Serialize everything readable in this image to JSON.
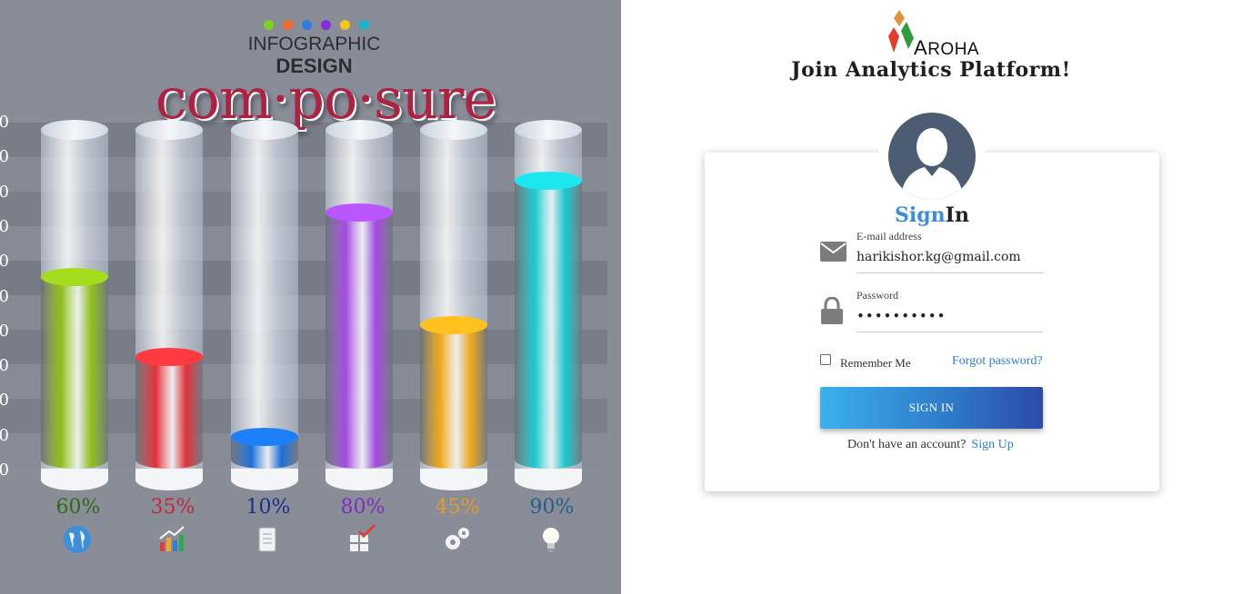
{
  "hero": {
    "dot_colors": [
      "#7ed321",
      "#f56a2a",
      "#2a7fe0",
      "#8a2be2",
      "#f5c518",
      "#19b4c6"
    ],
    "title_line1": "INFOGRAPHIC",
    "title_line2": "DESIGN",
    "brand": "com·po·sure",
    "chart_data": {
      "type": "bar",
      "categories": [
        "earth",
        "growth",
        "scroll",
        "checklist",
        "settings",
        "idea"
      ],
      "values": [
        60,
        35,
        10,
        80,
        45,
        90
      ],
      "value_labels": [
        "60%",
        "35%",
        "10%",
        "80%",
        "45%",
        "90%"
      ],
      "ylim": [
        0,
        100
      ],
      "series_colors": [
        "#8fbf1a",
        "#e03238",
        "#1a6fd8",
        "#a24be0",
        "#f0a81a",
        "#19c9cf"
      ],
      "label_colors": [
        "#2e6b16",
        "#c0283a",
        "#1b2f8a",
        "#7b2fbf",
        "#e79a2a",
        "#235f8a"
      ],
      "icons": [
        "globe-icon",
        "growth-chart-icon",
        "scroll-icon",
        "checklist-icon",
        "gears-icon",
        "lightbulb-icon"
      ]
    }
  },
  "logo": {
    "text_first": "A",
    "text_rest": "ROHA"
  },
  "title": "Join Analytics Platform!",
  "card": {
    "heading_part1": "Sign",
    "heading_part2": "In",
    "email_label": "E-mail address",
    "email_value": "harikishor.kg@gmail.com",
    "password_label": "Password",
    "password_value": "••••••••••",
    "remember_label": "Remember Me",
    "remember_checked": false,
    "forgot_label": "Forgot password?",
    "signin_label": "SIGN IN",
    "no_account_text": "Don't have an account?",
    "signup_label": "Sign Up"
  }
}
